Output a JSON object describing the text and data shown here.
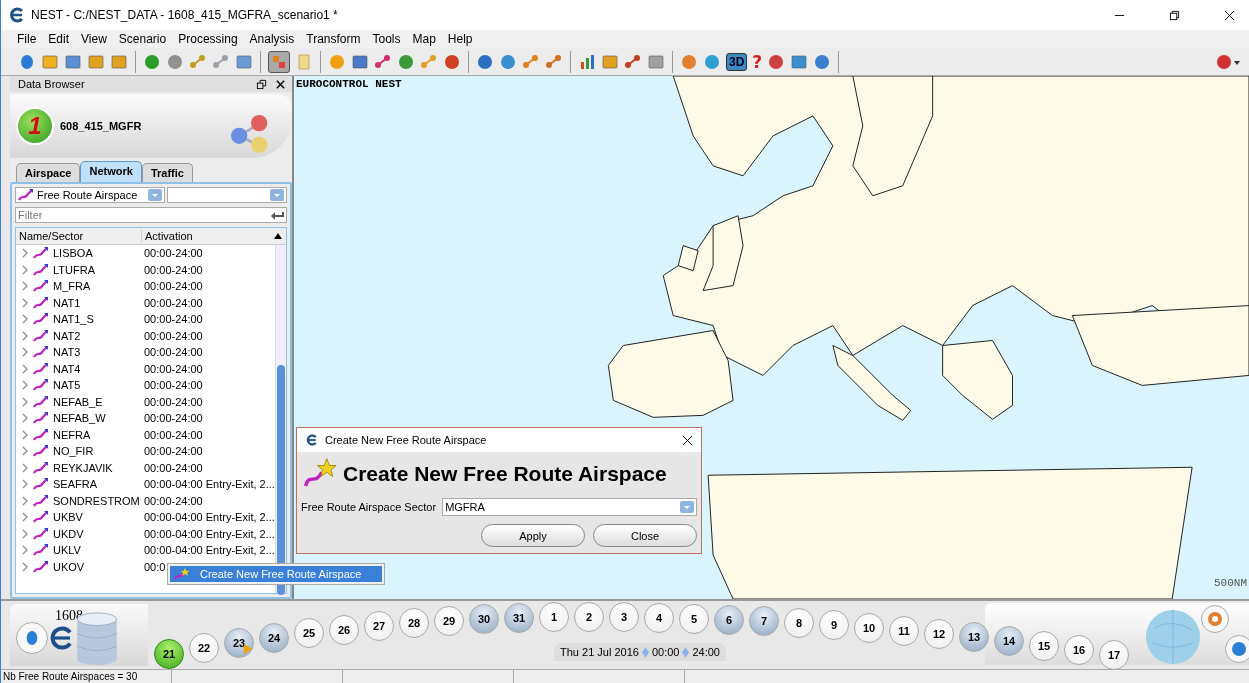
{
  "window": {
    "title": "NEST - C:/NEST_DATA - 1608_415_MGFRA_scenario1 *"
  },
  "menu": [
    "File",
    "Edit",
    "View",
    "Scenario",
    "Processing",
    "Analysis",
    "Transform",
    "Tools",
    "Map",
    "Help"
  ],
  "toolbar": {
    "select_pressed": true,
    "view_3d": {
      "label": "3D",
      "pressed": true
    },
    "help_label": "?"
  },
  "data_browser": {
    "title": "Data Browser",
    "scenario": {
      "number": "1",
      "name": "608_415_MGFR"
    },
    "tabs": [
      {
        "label": "Airspace",
        "selected": false
      },
      {
        "label": "Network",
        "selected": true
      },
      {
        "label": "Traffic",
        "selected": false
      }
    ],
    "layer_combo": "Free Route Airspace",
    "filter": {
      "placeholder": "Filter"
    },
    "columns": [
      "Name/Sector",
      "Activation"
    ],
    "rows": [
      {
        "name": "LISBOA",
        "activation": "00:00-24:00"
      },
      {
        "name": "LTUFRA",
        "activation": "00:00-24:00"
      },
      {
        "name": "M_FRA",
        "activation": "00:00-24:00"
      },
      {
        "name": "NAT1",
        "activation": "00:00-24:00"
      },
      {
        "name": "NAT1_S",
        "activation": "00:00-24:00"
      },
      {
        "name": "NAT2",
        "activation": "00:00-24:00"
      },
      {
        "name": "NAT3",
        "activation": "00:00-24:00"
      },
      {
        "name": "NAT4",
        "activation": "00:00-24:00"
      },
      {
        "name": "NAT5",
        "activation": "00:00-24:00"
      },
      {
        "name": "NEFAB_E",
        "activation": "00:00-24:00"
      },
      {
        "name": "NEFAB_W",
        "activation": "00:00-24:00"
      },
      {
        "name": "NEFRA",
        "activation": "00:00-24:00"
      },
      {
        "name": "NO_FIR",
        "activation": "00:00-24:00"
      },
      {
        "name": "REYKJAVIK",
        "activation": "00:00-24:00"
      },
      {
        "name": "SEAFRA",
        "activation": "00:00-04:00 Entry-Exit, 2..."
      },
      {
        "name": "SONDRESTROM",
        "activation": "00:00-24:00"
      },
      {
        "name": "UKBV",
        "activation": "00:00-04:00 Entry-Exit, 2..."
      },
      {
        "name": "UKDV",
        "activation": "00:00-04:00 Entry-Exit, 2..."
      },
      {
        "name": "UKLV",
        "activation": "00:00-04:00 Entry-Exit, 2..."
      },
      {
        "name": "UKOV",
        "activation": "00:0"
      }
    ]
  },
  "context_menu": {
    "items": [
      {
        "label": "Create New Free Route Airspace",
        "selected": true
      }
    ]
  },
  "map": {
    "title": "EUROCONTROL NEST",
    "scale": "500NM"
  },
  "dialog": {
    "title": "Create New Free Route Airspace",
    "heading": "Create New Free Route Airspace",
    "field_label": "Free Route Airspace Sector",
    "field_value": "MGFRA",
    "buttons": [
      "Apply",
      "Close"
    ]
  },
  "timeline": {
    "year_label": "1608",
    "date": "Thu 21 Jul 2016",
    "start": "00:00",
    "end": "24:00",
    "days": [
      {
        "label": "21",
        "selected": true,
        "weekend": false,
        "marker": false
      },
      {
        "label": "22",
        "selected": false,
        "weekend": false,
        "marker": false
      },
      {
        "label": "23",
        "selected": false,
        "weekend": true,
        "marker": true
      },
      {
        "label": "24",
        "selected": false,
        "weekend": true,
        "marker": false
      },
      {
        "label": "25",
        "selected": false,
        "weekend": false,
        "marker": false
      },
      {
        "label": "26",
        "selected": false,
        "weekend": false,
        "marker": false
      },
      {
        "label": "27",
        "selected": false,
        "weekend": false,
        "marker": false
      },
      {
        "label": "28",
        "selected": false,
        "weekend": false,
        "marker": false
      },
      {
        "label": "29",
        "selected": false,
        "weekend": false,
        "marker": false
      },
      {
        "label": "30",
        "selected": false,
        "weekend": true,
        "marker": false
      },
      {
        "label": "31",
        "selected": false,
        "weekend": true,
        "marker": false
      },
      {
        "label": "1",
        "selected": false,
        "weekend": false,
        "marker": false
      },
      {
        "label": "2",
        "selected": false,
        "weekend": false,
        "marker": false
      },
      {
        "label": "3",
        "selected": false,
        "weekend": false,
        "marker": false
      },
      {
        "label": "4",
        "selected": false,
        "weekend": false,
        "marker": false
      },
      {
        "label": "5",
        "selected": false,
        "weekend": false,
        "marker": false
      },
      {
        "label": "6",
        "selected": false,
        "weekend": true,
        "marker": false
      },
      {
        "label": "7",
        "selected": false,
        "weekend": true,
        "marker": false
      },
      {
        "label": "8",
        "selected": false,
        "weekend": false,
        "marker": false
      },
      {
        "label": "9",
        "selected": false,
        "weekend": false,
        "marker": false
      },
      {
        "label": "10",
        "selected": false,
        "weekend": false,
        "marker": false
      },
      {
        "label": "11",
        "selected": false,
        "weekend": false,
        "marker": false
      },
      {
        "label": "12",
        "selected": false,
        "weekend": false,
        "marker": false
      },
      {
        "label": "13",
        "selected": false,
        "weekend": true,
        "marker": false
      },
      {
        "label": "14",
        "selected": false,
        "weekend": true,
        "marker": false
      },
      {
        "label": "15",
        "selected": false,
        "weekend": false,
        "marker": false
      },
      {
        "label": "16",
        "selected": false,
        "weekend": false,
        "marker": false
      },
      {
        "label": "17",
        "selected": false,
        "weekend": false,
        "marker": false
      }
    ]
  },
  "status_bar": [
    "Nb Free Route Airspaces = 30"
  ]
}
